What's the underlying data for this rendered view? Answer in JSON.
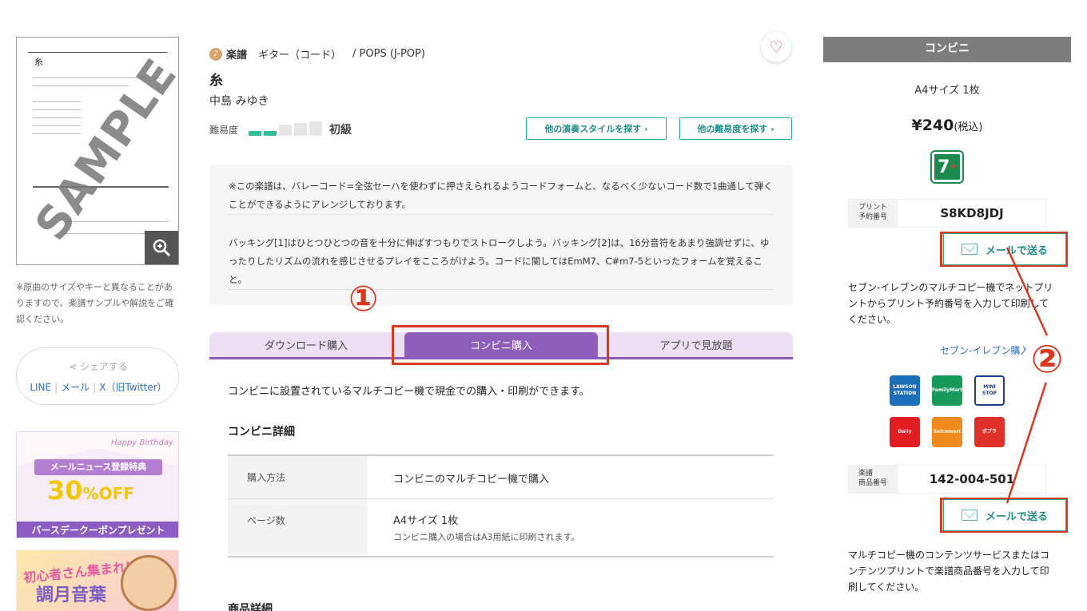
{
  "sample": {
    "sheet_title": "糸",
    "watermark": "SAMPLE"
  },
  "left_note": "※原曲のサイズやキーと異なることがありますので、楽譜サンプルや解説をご確認ください。",
  "share": {
    "title": "シェアする",
    "line": "LINE",
    "mail": "メール",
    "x": "X（旧Twitter）"
  },
  "banner1": {
    "happy": "Happy Birthday",
    "news": "メールニュース登録特典",
    "percent": "30",
    "off": "%OFF",
    "coupon": "バースデークーポンプレゼント"
  },
  "banner2": {
    "line1": "初心者さん集まれ!",
    "line2": "調月音葉"
  },
  "breadcrumb": {
    "category": "楽譜",
    "instrument": "ギター（コード）",
    "genre": "/ POPS (J-POP)"
  },
  "song": {
    "title": "糸",
    "artist": "中島 みゆき"
  },
  "difficulty": {
    "label": "難易度",
    "level_text": "初級",
    "level": 2,
    "max": 5
  },
  "buttons": {
    "other_style": "他の演奏スタイルを探す ›",
    "other_level": "他の難易度を探す ›"
  },
  "description": {
    "p1": "※この楽譜は、バレーコード=全弦セーハを使わずに押さえられるようコードフォームと、なるべく少ないコード数で1曲通して弾くことができるようにアレンジしております。",
    "p2": "バッキング[1]はひとつひとつの音を十分に伸ばすつもりでストロークしよう。バッキング[2]は、16分音符をあまり強調せずに、ゆったりしたリズムの流れを感じさせるプレイをこころがけよう。コードに関してはEmM7、C#m7-5といったフォームを覚えること。"
  },
  "annotations": {
    "one": "①",
    "two": "②"
  },
  "tabs": [
    "ダウンロード購入",
    "コンビニ購入",
    "アプリで見放題"
  ],
  "intro": "コンビニに設置されているマルチコピー機で現金での購入・印刷ができます。",
  "detail": {
    "heading": "コンビニ詳細",
    "rows": [
      {
        "key": "購入方法",
        "value": "コンビニのマルチコピー機で購入",
        "sub": ""
      },
      {
        "key": "ページ数",
        "value": "A4サイズ 1枚",
        "sub": "コンビニ購入の場合はA3用紙に印刷されます。"
      }
    ]
  },
  "product_heading": "商品詳細",
  "side": {
    "header": "コンビニ",
    "size": "A4サイズ 1枚",
    "price": "¥240",
    "tax": "(税込)",
    "print_label": "プリント\n予約番号",
    "print_code": "S8KD8JDJ",
    "mail_label": "メールで送る",
    "seven_text": "セブン-イレブンのマルチコピー機でネットプリントからプリント予約番号を入力して印刷してください。",
    "seven_link": "セブン-イレブン購入",
    "product_label": "楽譜\n商品番号",
    "product_code": "142-004-501",
    "multi_text": "マルチコピー機のコンテンツサービスまたはコンテンツプリントで楽譜商品番号を入力して印刷してください。"
  },
  "stores": [
    {
      "name": "LAWSON STATION",
      "color": "#1b6fb8"
    },
    {
      "name": "FamilyMart",
      "color": "#1a9a5a"
    },
    {
      "name": "MINI STOP",
      "color": "#ffffff"
    },
    {
      "name": "Daily",
      "color": "#e21e24"
    },
    {
      "name": "Seicomart",
      "color": "#f08a1c"
    },
    {
      "name": "ポプラ",
      "color": "#e0302a"
    }
  ],
  "colors": {
    "accent": "#8d5fbb",
    "teal": "#2ba5a0",
    "annotation": "#d9391f"
  }
}
